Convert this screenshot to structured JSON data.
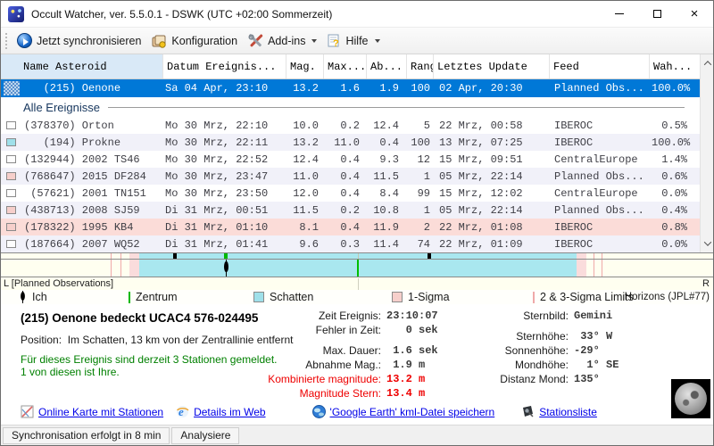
{
  "window": {
    "title": "Occult Watcher, ver. 5.5.0.1 - DSWK (UTC +02:00 Sommerzeit)"
  },
  "icons": {
    "close": "×"
  },
  "toolbar": {
    "sync": "Jetzt synchronisieren",
    "config": "Konfiguration",
    "addins": "Add-ins",
    "help": "Hilfe"
  },
  "table": {
    "columns": [
      "Name Asteroid",
      "Datum Ereignis...",
      "Mag.",
      "Max...",
      "Ab...",
      "Rang",
      "Letztes Update",
      "Feed",
      "Wah..."
    ],
    "selected": {
      "name": "   (215) Oenone",
      "datum": "Sa 04 Apr, 23:10",
      "mag": "13.2",
      "max": "1.6",
      "ab": "1.9",
      "rang": "100",
      "update": "02 Apr, 20:30",
      "feed": "Planned Obs...",
      "wahr": "100.0%"
    },
    "group_label": "Alle Ereignisse",
    "rows": [
      {
        "chip": "white",
        "name": "(378370) Orton",
        "datum": "Mo 30 Mrz, 22:10",
        "mag": "10.0",
        "max": "0.2",
        "ab": "12.4",
        "rang": "5",
        "update": "22 Mrz, 00:58",
        "feed": "IBEROC",
        "wahr": "0.5%"
      },
      {
        "chip": "cyan",
        "name": "   (194) Prokne",
        "datum": "Mo 30 Mrz, 22:11",
        "mag": "13.2",
        "max": "11.0",
        "ab": "0.4",
        "rang": "100",
        "update": "13 Mrz, 07:25",
        "feed": "IBEROC",
        "wahr": "100.0%"
      },
      {
        "chip": "white",
        "name": "(132944) 2002 TS46",
        "datum": "Mo 30 Mrz, 22:52",
        "mag": "12.4",
        "max": "0.4",
        "ab": "9.3",
        "rang": "12",
        "update": "15 Mrz, 09:51",
        "feed": "CentralEurope",
        "wahr": "1.4%"
      },
      {
        "chip": "pink",
        "name": "(768647) 2015 DF284",
        "datum": "Mo 30 Mrz, 23:47",
        "mag": "11.0",
        "max": "0.4",
        "ab": "11.5",
        "rang": "1",
        "update": "05 Mrz, 22:14",
        "feed": "Planned Obs...",
        "wahr": "0.6%"
      },
      {
        "chip": "white",
        "name": " (57621) 2001 TN151",
        "datum": "Mo 30 Mrz, 23:50",
        "mag": "12.0",
        "max": "0.4",
        "ab": "8.4",
        "rang": "99",
        "update": "15 Mrz, 12:02",
        "feed": "CentralEurope",
        "wahr": "0.0%"
      },
      {
        "chip": "pink",
        "name": "(438713) 2008 SJ59",
        "datum": "Di 31 Mrz, 00:51",
        "mag": "11.5",
        "max": "0.2",
        "ab": "10.8",
        "rang": "1",
        "update": "05 Mrz, 22:14",
        "feed": "Planned Obs...",
        "wahr": "0.4%"
      },
      {
        "chip": "pink",
        "name": "(178322) 1995 KB4",
        "datum": "Di 31 Mrz, 01:10",
        "mag": "8.1",
        "max": "0.4",
        "ab": "11.9",
        "rang": "2",
        "update": "22 Mrz, 01:08",
        "feed": "IBEROC",
        "wahr": "0.8%"
      },
      {
        "chip": "white",
        "name": "(187664) 2007 WQ52",
        "datum": "Di 31 Mrz, 01:41",
        "mag": "9.6",
        "max": "0.3",
        "ab": "11.4",
        "rang": "74",
        "update": "22 Mrz, 01:09",
        "feed": "IBEROC",
        "wahr": "0.0%"
      }
    ]
  },
  "strip": {
    "left_label": "L [Planned Observations]",
    "right_label": "R",
    "legend": {
      "ich": "Ich",
      "zentrum": "Zentrum",
      "schatten": "Schatten",
      "sigma1": "1-Sigma",
      "sigma23": "2 & 3-Sigma Limits",
      "source": "Horizons (JPL#77)"
    }
  },
  "details": {
    "title": "(215) Oenone bedeckt UCAC4 576-024495",
    "position_line": "Position:  Im Schatten, 13 km von der Zentrallinie entfernt",
    "stations_line1": "Für dieses Ereignis sind derzeit 3 Stationen gemeldet.",
    "stations_line2": "1 von diesen ist Ihre.",
    "mid": [
      {
        "label": "Zeit Ereignis:",
        "value": "23:10:07"
      },
      {
        "label": "Fehler in Zeit:",
        "value": "   0 sek"
      },
      {
        "label": "Max. Dauer:",
        "value": " 1.6 sek"
      },
      {
        "label": "Abnahme Mag.:",
        "value": " 1.9 m"
      },
      {
        "label": "Kombinierte magnitude:",
        "value": "13.2 m"
      },
      {
        "label": "Magnitude Stern:",
        "value": "13.4 m"
      }
    ],
    "right": [
      {
        "label": "Sternbild:",
        "value": "Gemini"
      },
      {
        "label": "Sternhöhe:",
        "value": " 33° W"
      },
      {
        "label": "Sonnenhöhe:",
        "value": "-29°"
      },
      {
        "label": "Mondhöhe:",
        "value": "  1° SE"
      },
      {
        "label": "Distanz Mond:",
        "value": "135°"
      }
    ]
  },
  "links": {
    "map": "Online Karte mit Stationen",
    "web": "Details im Web",
    "kml": "'Google Earth' kml-Datei speichern",
    "stations": "Stationsliste"
  },
  "statusbar": {
    "sync": "Synchronisation erfolgt in 8 min",
    "analyze": "Analysiere"
  },
  "colors": {
    "selection": "#0078d7",
    "shadow_band": "#a9e7ef",
    "sigma_band": "#fadcdc",
    "center_line": "#00b800",
    "alert_red": "#ee0000",
    "station_green": "#008000",
    "link_blue": "#0000e8"
  }
}
